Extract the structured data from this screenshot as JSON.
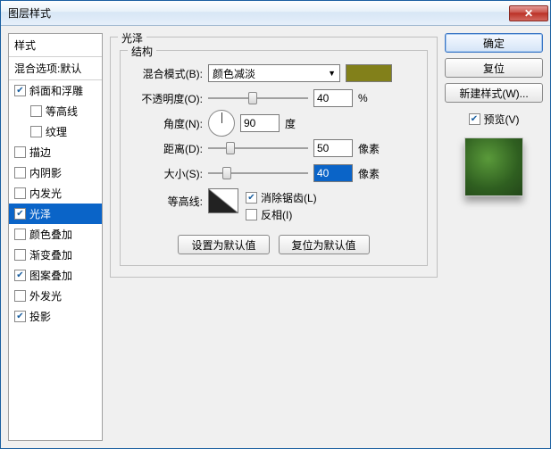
{
  "window": {
    "title": "图层样式"
  },
  "styles": {
    "header": "样式",
    "blend_defaults": "混合选项:默认",
    "items": [
      {
        "label": "斜面和浮雕",
        "checked": true,
        "indent": false
      },
      {
        "label": "等高线",
        "checked": false,
        "indent": true
      },
      {
        "label": "纹理",
        "checked": false,
        "indent": true
      },
      {
        "label": "描边",
        "checked": false,
        "indent": false
      },
      {
        "label": "内阴影",
        "checked": false,
        "indent": false
      },
      {
        "label": "内发光",
        "checked": false,
        "indent": false
      },
      {
        "label": "光泽",
        "checked": true,
        "indent": false,
        "active": true
      },
      {
        "label": "颜色叠加",
        "checked": false,
        "indent": false
      },
      {
        "label": "渐变叠加",
        "checked": false,
        "indent": false
      },
      {
        "label": "图案叠加",
        "checked": true,
        "indent": false
      },
      {
        "label": "外发光",
        "checked": false,
        "indent": false
      },
      {
        "label": "投影",
        "checked": true,
        "indent": false
      }
    ]
  },
  "satin": {
    "group_title": "光泽",
    "structure_title": "结构",
    "blend_mode_label": "混合模式(B):",
    "blend_mode_value": "颜色减淡",
    "swatch_color": "#82801a",
    "opacity_label": "不透明度(O):",
    "opacity_value": "40",
    "opacity_unit": "%",
    "angle_label": "角度(N):",
    "angle_value": "90",
    "angle_unit": "度",
    "distance_label": "距离(D):",
    "distance_value": "50",
    "distance_unit": "像素",
    "size_label": "大小(S):",
    "size_value": "40",
    "size_unit": "像素",
    "contour_label": "等高线:",
    "antialias_label": "消除锯齿(L)",
    "antialias_checked": true,
    "invert_label": "反相(I)",
    "invert_checked": false,
    "btn_default": "设置为默认值",
    "btn_reset": "复位为默认值"
  },
  "right": {
    "ok": "确定",
    "cancel": "复位",
    "new_style": "新建样式(W)...",
    "preview_label": "预览(V)",
    "preview_checked": true
  }
}
